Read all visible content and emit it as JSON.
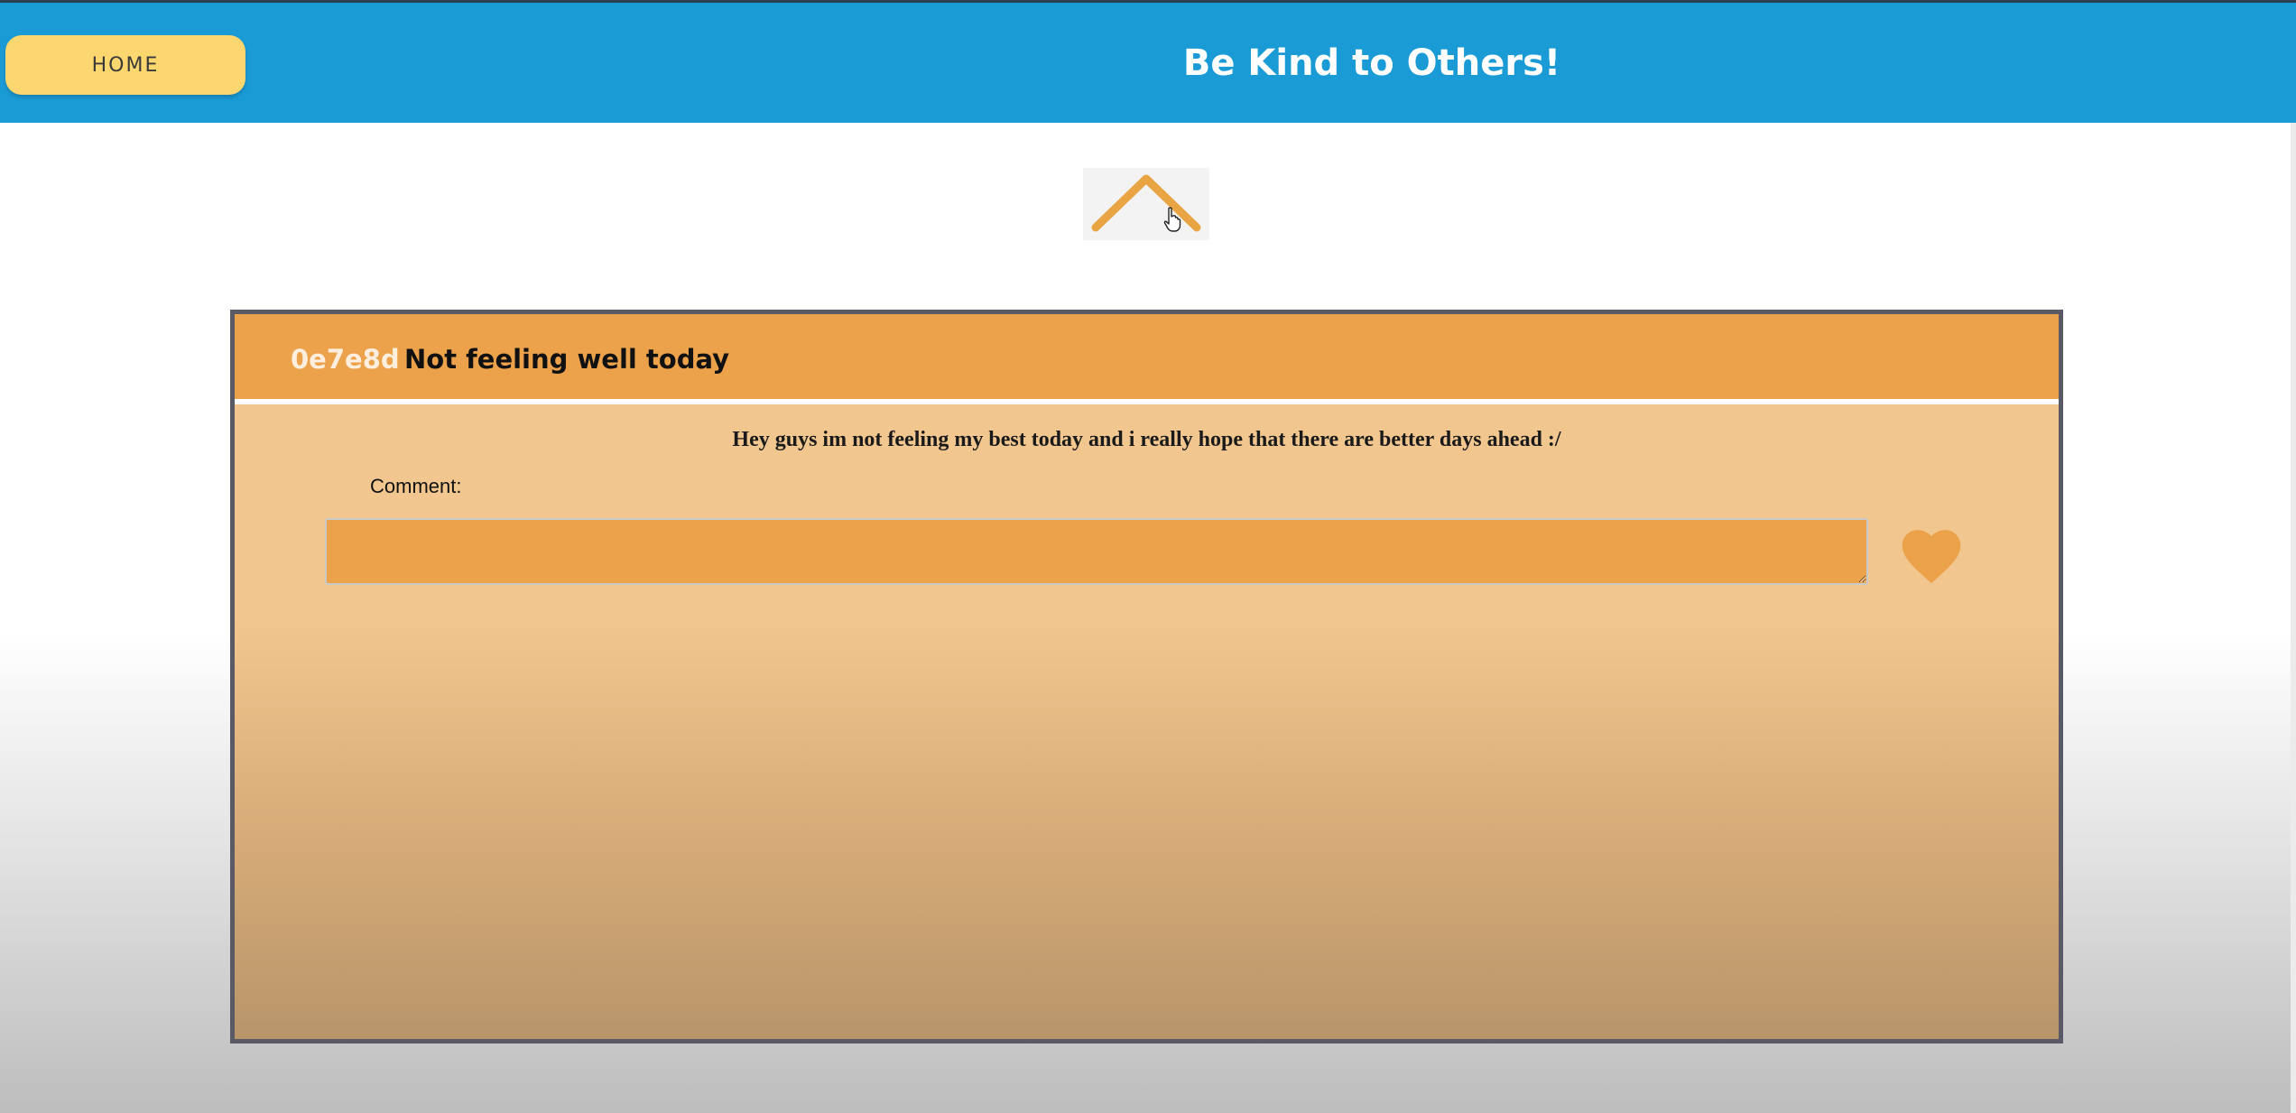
{
  "header": {
    "home_label": "HOME",
    "title": "Be Kind to Others!"
  },
  "post": {
    "id": "0e7e8d",
    "title": "Not feeling well today",
    "body": "Hey guys im not feeling my best today and i really hope that there are better days ahead :/",
    "comment_label": "Comment:",
    "comment_value": "",
    "comment_placeholder": ""
  },
  "icons": {
    "scroll_top": "chevron-up-icon",
    "like": "heart-icon"
  },
  "colors": {
    "header_bg": "#1b9bd6",
    "home_button": "#fcd770",
    "accent_orange": "#eca24b",
    "card_bg": "#f2c78f",
    "card_border": "#5a5a66"
  }
}
